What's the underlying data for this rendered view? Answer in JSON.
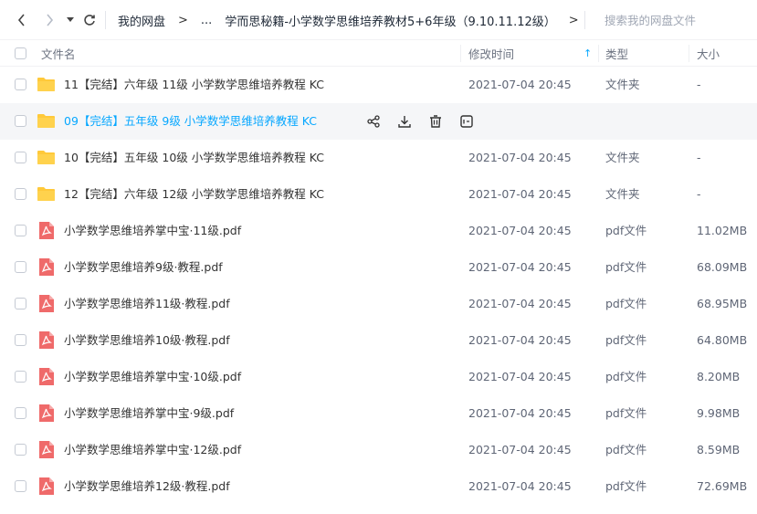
{
  "nav": {
    "crumbs": [
      "我的网盘",
      "...",
      "学而思秘籍-小学数学思维培养教材5+6年级（9.10.11.12级）"
    ],
    "crumb_arrow": ">"
  },
  "search": {
    "placeholder": "搜索我的网盘文件"
  },
  "header": {
    "name": "文件名",
    "time": "修改时间",
    "type": "类型",
    "size": "大小",
    "sort": "↑"
  },
  "accent": "#06a7ff",
  "rows": [
    {
      "kind": "folder",
      "name": "11【完结】六年级 11级 小学数学思维培养教程 KC",
      "time": "2021-07-04 20:45",
      "type": "文件夹",
      "size": "-"
    },
    {
      "kind": "folder",
      "name": "09【完结】五年级 9级 小学数学思维培养教程 KC",
      "time": "",
      "type": "",
      "size": "",
      "hover": true
    },
    {
      "kind": "folder",
      "name": "10【完结】五年级 10级 小学数学思维培养教程 KC",
      "time": "2021-07-04 20:45",
      "type": "文件夹",
      "size": "-"
    },
    {
      "kind": "folder",
      "name": "12【完结】六年级 12级 小学数学思维培养教程 KC",
      "time": "2021-07-04 20:45",
      "type": "文件夹",
      "size": "-"
    },
    {
      "kind": "pdf",
      "name": "小学数学思维培养掌中宝·11级.pdf",
      "time": "2021-07-04 20:45",
      "type": "pdf文件",
      "size": "11.02MB"
    },
    {
      "kind": "pdf",
      "name": "小学数学思维培养9级·教程.pdf",
      "time": "2021-07-04 20:45",
      "type": "pdf文件",
      "size": "68.09MB"
    },
    {
      "kind": "pdf",
      "name": "小学数学思维培养11级·教程.pdf",
      "time": "2021-07-04 20:45",
      "type": "pdf文件",
      "size": "68.95MB"
    },
    {
      "kind": "pdf",
      "name": "小学数学思维培养10级·教程.pdf",
      "time": "2021-07-04 20:45",
      "type": "pdf文件",
      "size": "64.80MB"
    },
    {
      "kind": "pdf",
      "name": "小学数学思维培养掌中宝·10级.pdf",
      "time": "2021-07-04 20:45",
      "type": "pdf文件",
      "size": "8.20MB"
    },
    {
      "kind": "pdf",
      "name": "小学数学思维培养掌中宝·9级.pdf",
      "time": "2021-07-04 20:45",
      "type": "pdf文件",
      "size": "9.98MB"
    },
    {
      "kind": "pdf",
      "name": "小学数学思维培养掌中宝·12级.pdf",
      "time": "2021-07-04 20:45",
      "type": "pdf文件",
      "size": "8.59MB"
    },
    {
      "kind": "pdf",
      "name": "小学数学思维培养12级·教程.pdf",
      "time": "2021-07-04 20:45",
      "type": "pdf文件",
      "size": "72.69MB"
    }
  ],
  "row_actions": [
    "share-icon",
    "download-icon",
    "delete-icon",
    "more-icon"
  ]
}
